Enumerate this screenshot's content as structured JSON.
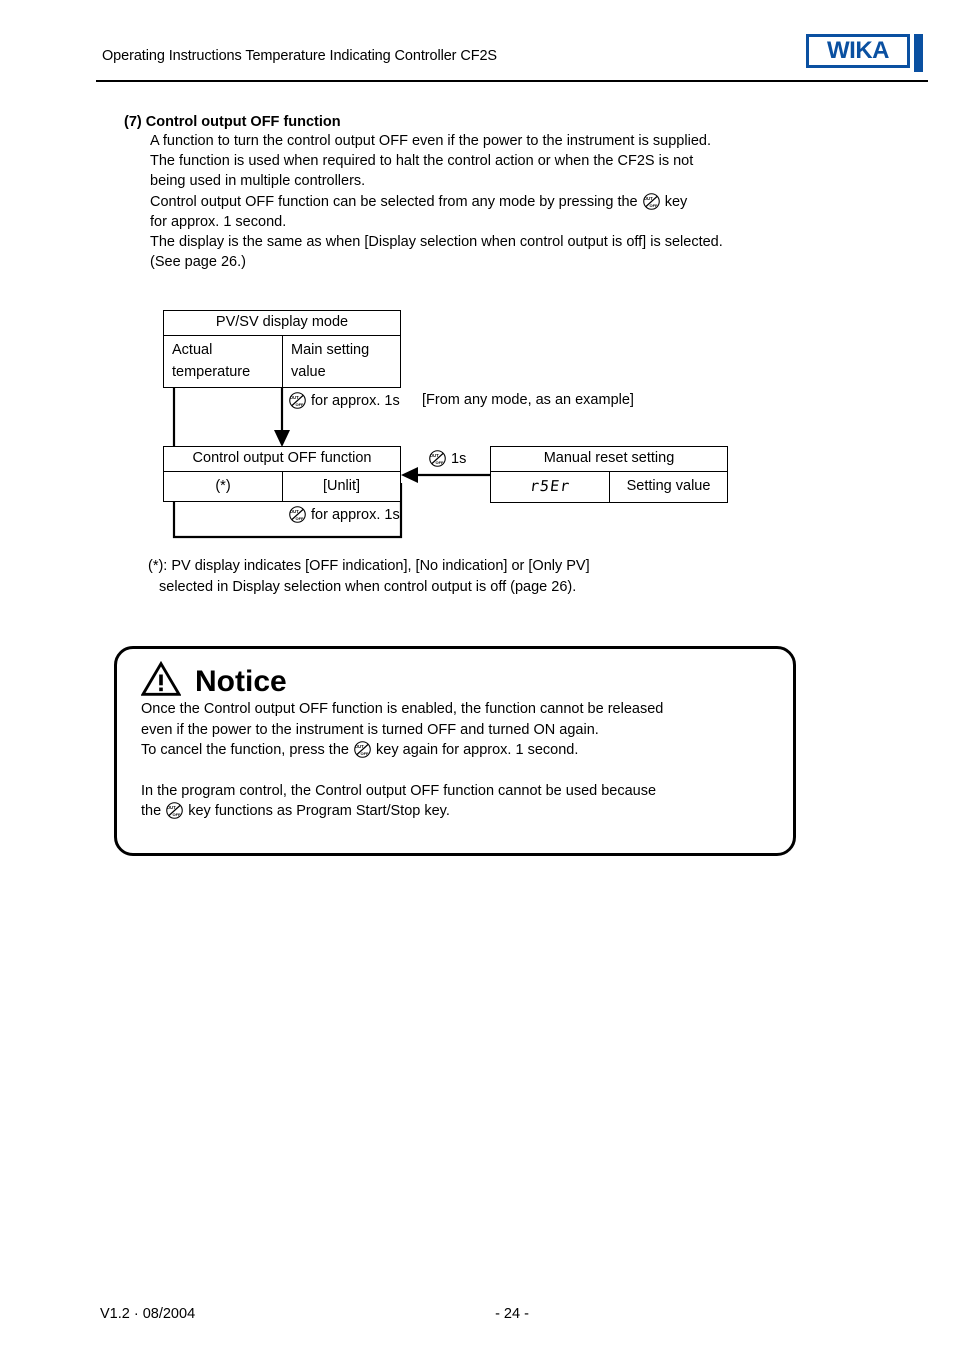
{
  "header": {
    "title": "Operating Instructions Temperature Indicating Controller CF2S",
    "logo_text": "WIKA",
    "logo_color": "#0a50a1"
  },
  "section": {
    "number": "(7)",
    "heading": "Control output OFF function",
    "lines": [
      "A function to turn the control output OFF even if the power to the instrument is supplied.",
      "The function is used when required to halt the control action or when the CF2S is not",
      "being used in multiple controllers.",
      "for approx. 1 second.",
      "The display is the same as when [Display selection when control output is off] is selected.",
      "(See page 26.)"
    ],
    "key_line_before": "Control output OFF function can be selected from any mode by pressing the",
    "key_line_after": "key"
  },
  "diagram": {
    "key_icon_name": "out-off-key-icon",
    "pvsv_box": {
      "title": "PV/SV display mode",
      "left_cell": "Actual\ntemperature",
      "left_cell_line1": "Actual",
      "left_cell_line2": "temperature",
      "right_cell_line1": "Main setting",
      "right_cell_line2": "value"
    },
    "ctrloff_box": {
      "title": "Control output OFF function",
      "left_cell": "(*)",
      "right_cell": "[Unlit]"
    },
    "manual_box": {
      "title": "Manual reset setting",
      "segment_display": "r5Er",
      "right_cell": "Setting value"
    },
    "labels": {
      "down_arrow": "for approx. 1s",
      "bracket_note": "[From any mode, as an example]",
      "left_arrow": "1s",
      "loop_back": "for approx. 1s"
    }
  },
  "footnote": {
    "line1": "(*): PV display indicates [OFF indication], [No indication] or [Only PV]",
    "line2": "selected in Display selection when control output is off (page 26)."
  },
  "notice": {
    "icon_name": "warning-triangle-icon",
    "title": "Notice",
    "para1_line1": "Once the Control output OFF function is enabled, the function cannot be released",
    "para1_line2": "even if the power to the instrument is turned OFF and turned ON again.",
    "para1_line3_before": "To cancel the function, press the",
    "para1_line3_after": "key again for approx. 1 second.",
    "para2_line1": "In the program control, the Control output OFF function cannot be used because",
    "para2_line2_before": "the",
    "para2_line2_after": "key functions as Program Start/Stop key."
  },
  "footer": {
    "version": "V1.2  ·  08/2004",
    "page": "- 24 -"
  }
}
